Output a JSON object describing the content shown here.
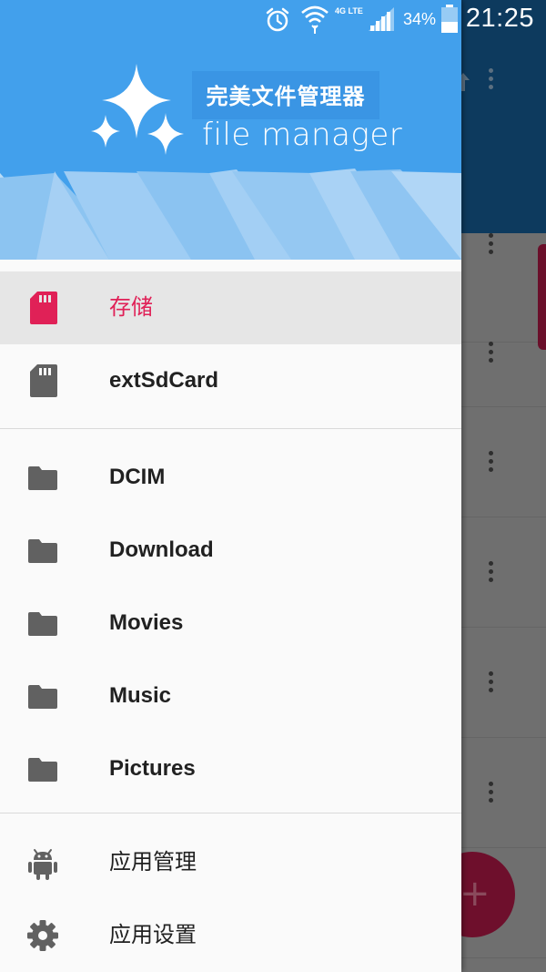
{
  "status_bar": {
    "time": "21:25",
    "battery": "34%",
    "network": "4G LTE"
  },
  "drawer": {
    "app_title": "完美文件管理器",
    "app_subtitle": "file manager",
    "storage": [
      {
        "label": "存储",
        "icon": "sd-card-icon",
        "active": true
      },
      {
        "label": "extSdCard",
        "icon": "sd-card-icon",
        "active": false
      }
    ],
    "folders": [
      {
        "label": "DCIM",
        "icon": "folder-icon"
      },
      {
        "label": "Download",
        "icon": "folder-icon"
      },
      {
        "label": "Movies",
        "icon": "folder-icon"
      },
      {
        "label": "Music",
        "icon": "folder-icon"
      },
      {
        "label": "Pictures",
        "icon": "folder-icon"
      }
    ],
    "actions": [
      {
        "label": "应用管理",
        "icon": "android-icon"
      },
      {
        "label": "应用设置",
        "icon": "gear-icon"
      }
    ]
  },
  "colors": {
    "header_blue": "#42a0ec",
    "accent_pink": "#e02157",
    "icon_gray": "#616161",
    "toolbar_dimmed": "#0d3a5e"
  }
}
